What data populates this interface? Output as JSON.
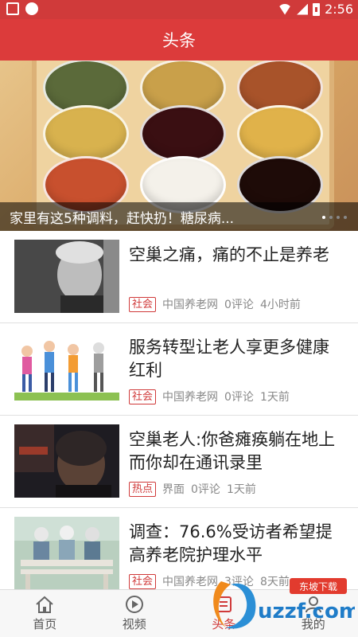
{
  "status_bar": {
    "time": "2:56"
  },
  "header": {
    "title": "头条"
  },
  "banner": {
    "caption": "家里有这5种调料，赶快扔！糖尿病...",
    "page_count": 4,
    "active_page": 1
  },
  "news": [
    {
      "title": "空巢之痛，痛的不止是养老",
      "tag": "社会",
      "source": "中国养老网",
      "comments": "0评论",
      "time": "4小时前",
      "thumb": "elderly-portrait-bw"
    },
    {
      "title": "服务转型让老人享更多健康红利",
      "tag": "社会",
      "source": "中国养老网",
      "comments": "0评论",
      "time": "1天前",
      "thumb": "cartoon-elderly-walking"
    },
    {
      "title": "空巢老人:你爸瘫痪躺在地上 而你却在通讯录里",
      "tag": "热点",
      "source": "界面",
      "comments": "0评论",
      "time": "1天前",
      "thumb": "elderly-woman-dark"
    },
    {
      "title": "调查：76.6%受访者希望提高养老院护理水平",
      "tag": "社会",
      "source": "中国养老网",
      "comments": "3评论",
      "time": "8天前",
      "thumb": "elderly-on-bench"
    }
  ],
  "tabs": [
    {
      "label": "首页",
      "icon": "home-icon",
      "active": false
    },
    {
      "label": "视频",
      "icon": "play-icon",
      "active": false
    },
    {
      "label": "头条",
      "icon": "headline-icon",
      "active": true
    },
    {
      "label": "我的",
      "icon": "user-icon",
      "active": false
    }
  ],
  "watermark": {
    "text": "uzzf.com",
    "subtext": "东坡下载"
  },
  "colors": {
    "brand": "#dc3b3b",
    "tag": "#d03a3a"
  }
}
